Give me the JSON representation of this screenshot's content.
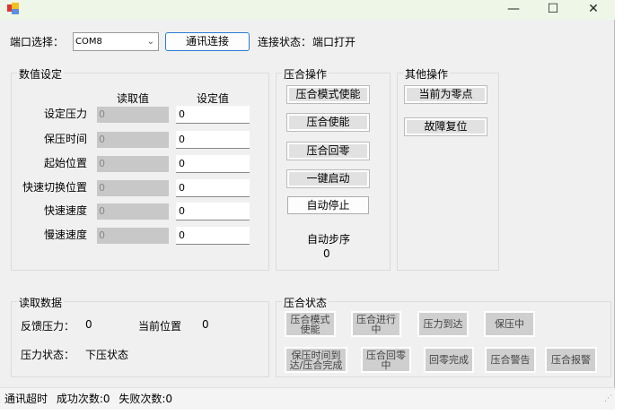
{
  "titlebar": {
    "min": "—",
    "max": "☐",
    "close": "✕"
  },
  "port": {
    "label": "端口选择：",
    "value": "COM8",
    "connect_button": "通讯连接",
    "status_label": "连接状态：",
    "status_value": "端口打开"
  },
  "values_group": {
    "title": "数值设定",
    "col_read": "读取值",
    "col_set": "设定值",
    "rows": [
      {
        "label": "设定压力",
        "read": "0",
        "set": "0"
      },
      {
        "label": "保压时间",
        "read": "0",
        "set": "0"
      },
      {
        "label": "起始位置",
        "read": "0",
        "set": "0"
      },
      {
        "label": "快速切换位置",
        "read": "0",
        "set": "0"
      },
      {
        "label": "快速速度",
        "read": "0",
        "set": "0"
      },
      {
        "label": "慢速速度",
        "read": "0",
        "set": "0"
      }
    ]
  },
  "press_ops": {
    "title": "压合操作",
    "buttons": [
      "压合模式使能",
      "压合使能",
      "压合回零",
      "一键启动"
    ],
    "stop": "自动停止",
    "step_label": "自动步序",
    "step_value": "0"
  },
  "other_ops": {
    "title": "其他操作",
    "buttons": [
      "当前为零点",
      "故障复位"
    ]
  },
  "read_data": {
    "title": "读取数据",
    "feedback_label": "反馈压力：",
    "feedback_value": "0",
    "position_label": "当前位置",
    "position_value": "0",
    "state_label": "压力状态：",
    "state_value": "下压状态"
  },
  "press_state": {
    "title": "压合状态",
    "row1": [
      "压合模式使能",
      "压合进行中",
      "压力到达",
      "保压中"
    ],
    "row2": [
      "保压时间到达/压合完成",
      "压合回零中",
      "回零完成",
      "压合警告",
      "压合报警"
    ]
  },
  "statusbar": {
    "timeout": "通讯超时",
    "success": "成功次数:0",
    "fail": "失败次数:0"
  }
}
